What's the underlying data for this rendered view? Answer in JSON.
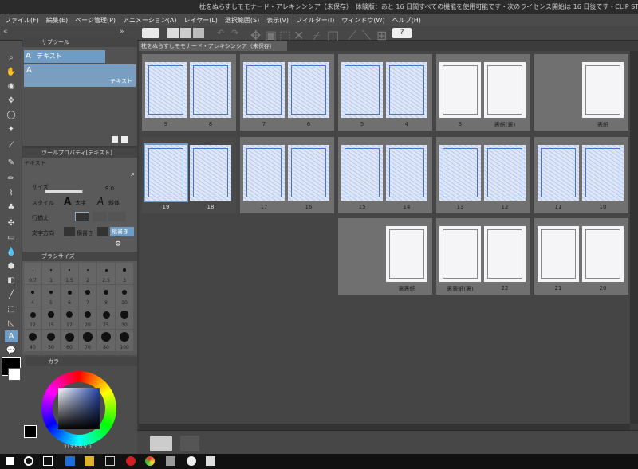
{
  "window": {
    "title": "枕をぬらすしモモナード・アレキシンシア（未保存）　体験版：あと 16 日間すべての機能を使用可能です・次のライセンス開始は 16 日後です - CLIP STUDIO PAINT EX"
  },
  "menu": [
    "ファイル(F)",
    "編集(E)",
    "ページ管理(P)",
    "アニメーション(A)",
    "レイヤー(L)",
    "選択範囲(S)",
    "表示(V)",
    "フィルター(I)",
    "ウィンドウ(W)",
    "ヘルプ(H)"
  ],
  "subtool": {
    "header": "サブツール",
    "group_label": "テキスト",
    "item_label": "テキスト"
  },
  "toolprop": {
    "header": "ツールプロパティ[テキスト]",
    "title": "テキスト",
    "size_label": "サイズ",
    "size_value": "9.0",
    "style_label": "スタイル",
    "bold_label": "太字",
    "italic_label": "斜体",
    "align_label": "行揃え",
    "direction_label": "文字方向",
    "horizontal_label": "横書き",
    "vertical_label": "縦書き"
  },
  "brushsize": {
    "header": "ブラシサイズ",
    "sizes": [
      "0.7",
      "1",
      "1.5",
      "2",
      "2.5",
      "3",
      "4",
      "5",
      "6",
      "7",
      "8",
      "10",
      "12",
      "15",
      "17",
      "20",
      "25",
      "30",
      "40",
      "50",
      "60",
      "70",
      "80",
      "100"
    ]
  },
  "color": {
    "header": "カラ",
    "hsv_values": "213 S 0 V 0",
    "wheel_hue_color": "#2244aa"
  },
  "document_tab": "枕をぬらすしモモナード・アレキシンシア（未保存）",
  "pages": {
    "row1": [
      {
        "left": "9",
        "right": "8"
      },
      {
        "left": "7",
        "right": "6"
      },
      {
        "left": "5",
        "right": "4"
      },
      {
        "left": "3",
        "right": "表紙(裏)"
      },
      {
        "left": "",
        "right": "表紙"
      }
    ],
    "row2": [
      {
        "left": "19",
        "right": "18"
      },
      {
        "left": "17",
        "right": "16"
      },
      {
        "left": "15",
        "right": "14"
      },
      {
        "left": "13",
        "right": "12"
      },
      {
        "left": "11",
        "right": "10"
      }
    ],
    "row3": [
      {
        "left": "",
        "right": "裏表紙"
      },
      {
        "left": "裏表紙(裏)",
        "right": "22"
      },
      {
        "left": "21",
        "right": "20"
      }
    ]
  },
  "accent": "#6e9cc4"
}
